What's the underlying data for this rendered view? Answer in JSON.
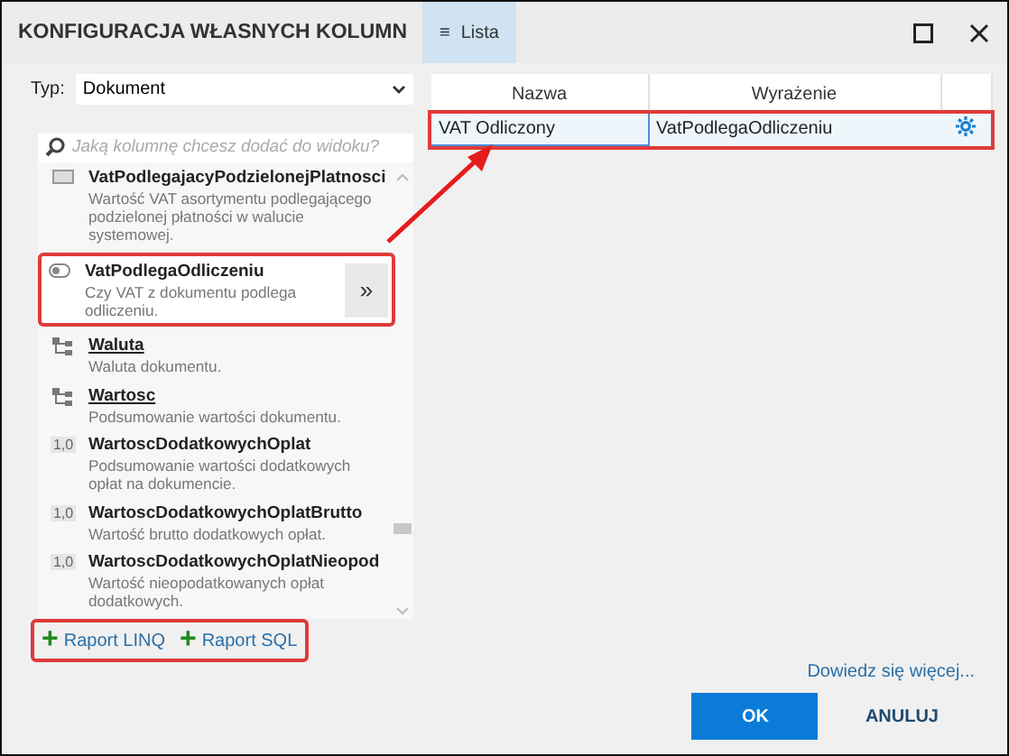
{
  "window": {
    "title": "KONFIGURACJA WŁASNYCH KOLUMN",
    "view_button": {
      "icon": "≡",
      "label": "Lista"
    }
  },
  "type_field": {
    "label": "Typ:",
    "value": "Dokument"
  },
  "search": {
    "placeholder": "Jaką kolumnę chcesz dodać do widoku?"
  },
  "columns_list": [
    {
      "kind": "text",
      "name": "VatPodlegajacyPodzielonejPlatnosci",
      "description": "Wartość VAT asortymentu podlegającego podzielonej płatności w walucie systemowej.",
      "selected": false
    },
    {
      "kind": "bool",
      "name": "VatPodlegaOdliczeniu",
      "description": "Czy VAT z dokumentu podlega odliczeniu.",
      "selected": true,
      "add_button": "»"
    },
    {
      "kind": "object",
      "name": "Waluta",
      "description": "Waluta dokumentu.",
      "selected": false
    },
    {
      "kind": "object",
      "name": "Wartosc",
      "description": "Podsumowanie wartości dokumentu.",
      "selected": false
    },
    {
      "kind": "number",
      "type_badge": "1,0",
      "name": "WartoscDodatkowychOplat",
      "description": "Podsumowanie wartości dodatkowych opłat na dokumencie.",
      "selected": false
    },
    {
      "kind": "number",
      "type_badge": "1,0",
      "name": "WartoscDodatkowychOplatBrutto",
      "description": "Wartość brutto dodatkowych opłat.",
      "selected": false
    },
    {
      "kind": "number",
      "type_badge": "1,0",
      "name": "WartoscDodatkowychOplatNieopod",
      "description": "Wartość nieopodatkowanych opłat dodatkowych.",
      "selected": false
    }
  ],
  "report_buttons": [
    {
      "icon": "+",
      "label": "Raport LINQ"
    },
    {
      "icon": "+",
      "label": "Raport SQL"
    }
  ],
  "table": {
    "columns": [
      "Nazwa",
      "Wyrażenie"
    ],
    "rows": [
      {
        "name": "VAT Odliczony",
        "expression": "VatPodlegaOdliczeniu",
        "selected": true
      }
    ]
  },
  "learn_more": "Dowiedz się więcej...",
  "buttons": [
    {
      "kind": "primary",
      "label": "OK"
    },
    {
      "kind": "secondary",
      "label": "ANULUJ"
    }
  ]
}
